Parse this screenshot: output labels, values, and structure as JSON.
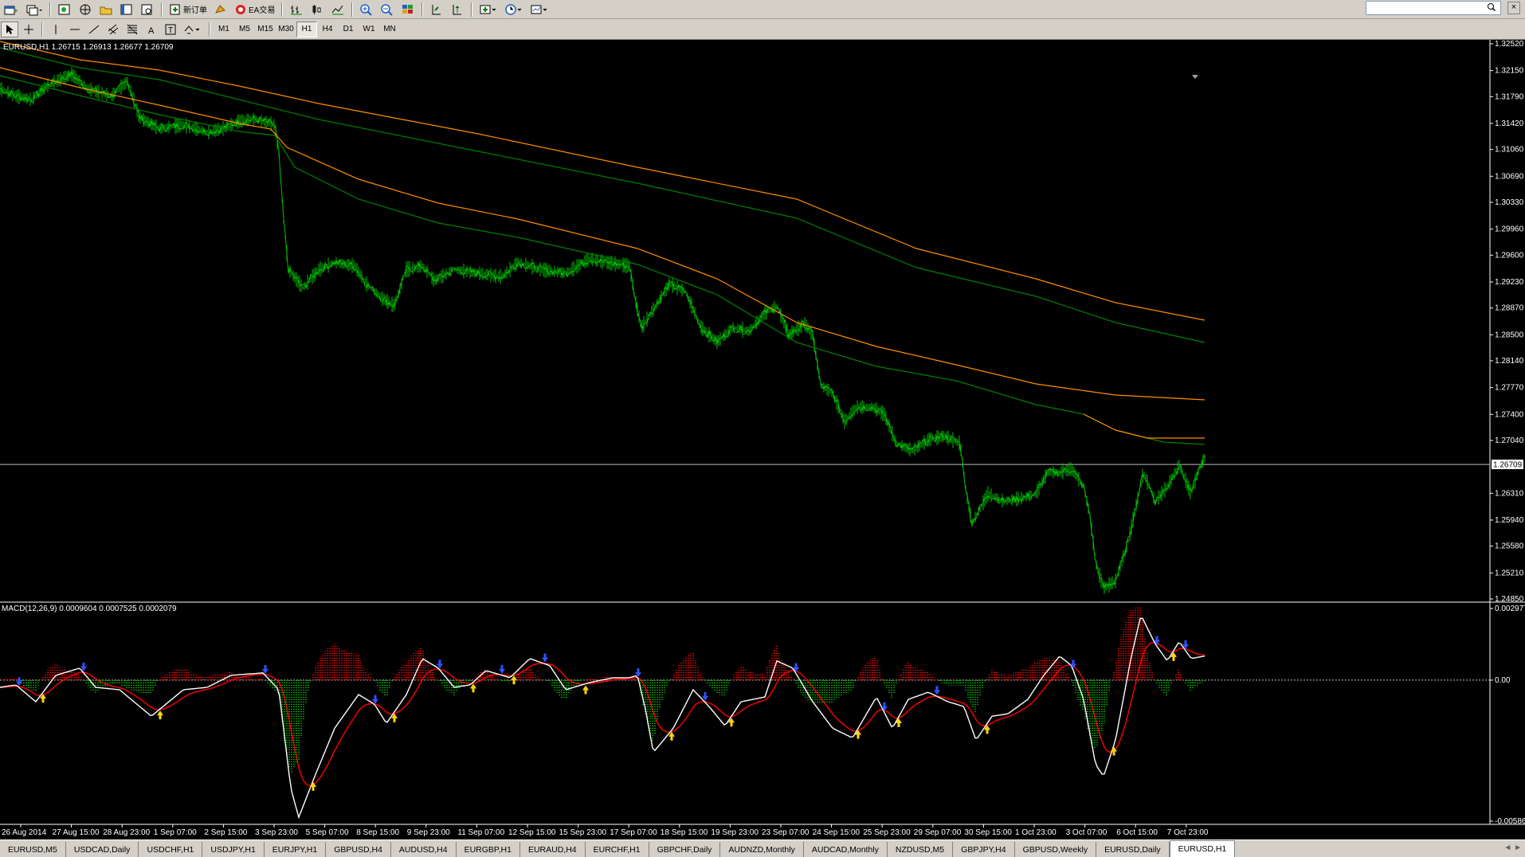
{
  "toolbar": {
    "new_order_label": "新订单",
    "ea_trading_label": "EA交易",
    "timeframes": [
      "M1",
      "M5",
      "M15",
      "M30",
      "H1",
      "H4",
      "D1",
      "W1",
      "MN"
    ],
    "active_timeframe": "H1"
  },
  "search": {
    "placeholder": ""
  },
  "chart": {
    "title": "EURUSD,H1  1.26715 1.26913 1.26677 1.26709",
    "current_price": "1.26709",
    "price_levels": [
      "1.32520",
      "1.32150",
      "1.31790",
      "1.31420",
      "1.31060",
      "1.30690",
      "1.30330",
      "1.29960",
      "1.29600",
      "1.29230",
      "1.28870",
      "1.28500",
      "1.28140",
      "1.27770",
      "1.27400",
      "1.27040",
      "1.26310",
      "1.25940",
      "1.25580",
      "1.25210",
      "1.24850"
    ],
    "time_labels": [
      "26 Aug 2014",
      "27 Aug 15:00",
      "28 Aug 23:00",
      "1 Sep 07:00",
      "2 Sep 15:00",
      "3 Sep 23:00",
      "5 Sep 07:00",
      "8 Sep 15:00",
      "9 Sep 23:00",
      "11 Sep 07:00",
      "12 Sep 15:00",
      "15 Sep 23:00",
      "17 Sep 07:00",
      "18 Sep 15:00",
      "19 Sep 23:00",
      "23 Sep 07:00",
      "24 Sep 15:00",
      "25 Sep 23:00",
      "29 Sep 07:00",
      "30 Sep 15:00",
      "1 Oct 23:00",
      "3 Oct 07:00",
      "6 Oct 15:00",
      "7 Oct 23:00"
    ],
    "colors": {
      "price": "#00c000",
      "ma_orange": "#ff8c00",
      "ma_green": "#008000",
      "macd_main": "#ffffff",
      "macd_signal": "#ff0000",
      "hist_up": "#ff0000",
      "hist_down": "#00c000"
    }
  },
  "macd": {
    "title": "MACD(12,26,9) 0.0009604 0.0007525 0.0002079",
    "levels": [
      "0.002977",
      "0.00",
      "-0.005861"
    ]
  },
  "tabs": [
    "EURUSD,M5",
    "USDCAD,Daily",
    "USDCHF,H1",
    "USDJPY,H1",
    "EURJPY,H1",
    "GBPUSD,H4",
    "AUDUSD,H4",
    "EURGBP,H1",
    "EURAUD,H4",
    "EURCHF,H1",
    "GBPCHF,Daily",
    "AUDNZD,Monthly",
    "AUDCAD,Monthly",
    "NZDUSD,M5",
    "GBPJPY,H4",
    "GBPUSD,Weekly",
    "EURUSD,Daily",
    "EURUSD,H1"
  ],
  "active_tab": "EURUSD,H1"
}
